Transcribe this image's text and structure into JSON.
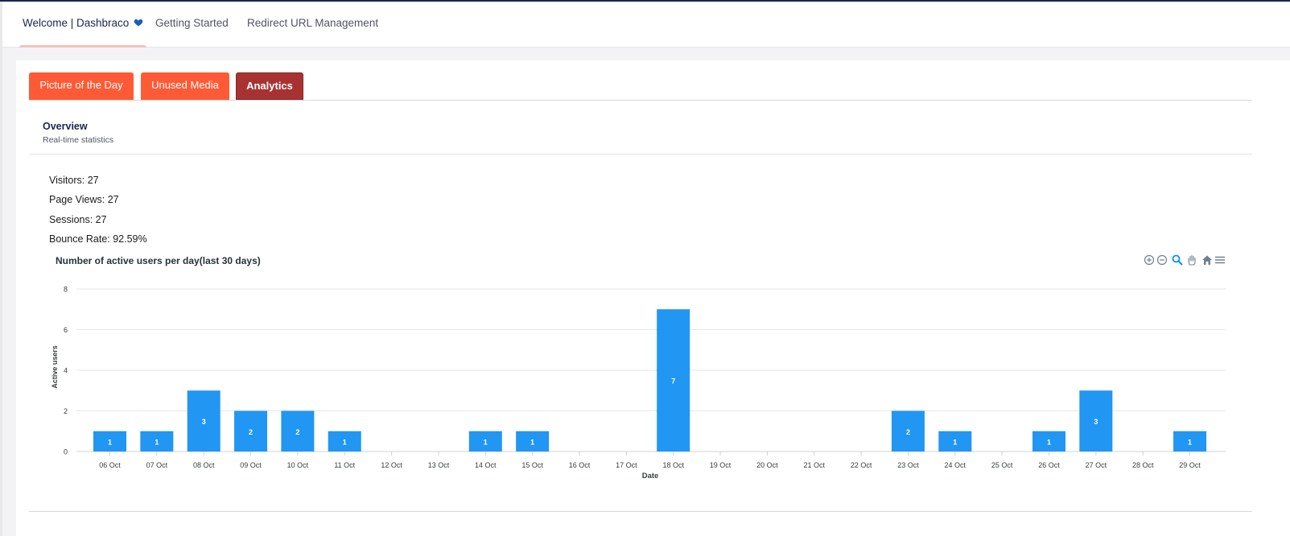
{
  "nav": {
    "tabs": [
      {
        "label": "Welcome | Dashbraco",
        "active": true
      },
      {
        "label": "Getting Started",
        "active": false
      },
      {
        "label": "Redirect URL Management",
        "active": false
      }
    ]
  },
  "subtabs": [
    {
      "label": "Picture of the Day",
      "color": "#ff5a36"
    },
    {
      "label": "Unused Media",
      "color": "#ff5a36"
    },
    {
      "label": "Analytics",
      "color": "#a83232",
      "active": true
    }
  ],
  "overview": {
    "title": "Overview",
    "subtitle": "Real-time statistics"
  },
  "stats": {
    "visitors": "Visitors: 27",
    "page_views": "Page Views: 27",
    "sessions": "Sessions: 27",
    "bounce_rate": "Bounce Rate: 92.59%"
  },
  "toolbar_icons": [
    "zoom-in-icon",
    "zoom-out-icon",
    "zoom-select-icon",
    "pan-hand-icon",
    "home-reset-icon",
    "menu-icon"
  ],
  "colors": {
    "bar": "#2196f3",
    "accent": "#1b264f",
    "tab": "#ff5a36",
    "tab_active": "#a83232"
  },
  "chart_data": {
    "type": "bar",
    "title": "Number of active users per day(last 30 days)",
    "xlabel": "Date",
    "ylabel": "Active users",
    "ylim": [
      0,
      8
    ],
    "yticks": [
      "0",
      "2",
      "4",
      "6",
      "8"
    ],
    "grid": true,
    "categories": [
      "06 Oct",
      "07 Oct",
      "08 Oct",
      "09 Oct",
      "10 Oct",
      "11 Oct",
      "12 Oct",
      "13 Oct",
      "14 Oct",
      "15 Oct",
      "16 Oct",
      "17 Oct",
      "18 Oct",
      "19 Oct",
      "20 Oct",
      "21 Oct",
      "22 Oct",
      "23 Oct",
      "24 Oct",
      "25 Oct",
      "26 Oct",
      "27 Oct",
      "28 Oct",
      "29 Oct"
    ],
    "values": [
      1,
      1,
      3,
      2,
      2,
      1,
      0,
      0,
      1,
      1,
      0,
      0,
      7,
      0,
      0,
      0,
      0,
      2,
      1,
      0,
      1,
      3,
      0,
      1
    ]
  }
}
